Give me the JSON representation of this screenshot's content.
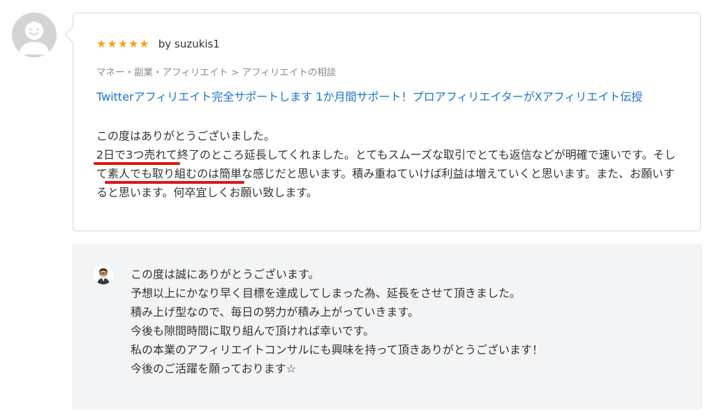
{
  "reviewer": {
    "avatar_icon": "default-user-avatar-icon"
  },
  "review": {
    "rating": 5,
    "star_color": "#f5a01a",
    "byline": "by suzukis1",
    "breadcrumb": "マネー・副業・アフィリエイト > アフィリエイトの相談",
    "service_title": "Twitterアフィリエイト完全サポートします 1か月間サポート！プロアフィリエイターがXアフィリエイト伝授",
    "link_color": "#1a73c9",
    "line1": "この度はありがとうございました。",
    "para2_hl1": "2日で3つ売れて",
    "para2_mid": "終了のところ延長してくれました。とてもスムーズな取引でとても返信などが明確で速いです。そして",
    "para2_hl2": "素人でも取り組むのは簡単",
    "para2_end": "な感じだと思います。積み重ねていけば利益は増えていくと思います。また、お願いすると思います。何卒宜しくお願い致します。",
    "underline_color": "#e01212"
  },
  "reply": {
    "avatar_icon": "seller-avatar-icon",
    "lines": [
      "この度は誠にありがとうございます。",
      "予想以上にかなり早く目標を達成してしまった為、延長をさせて頂きました。",
      "積み上げ型なので、毎日の努力が積み上がっていきます。",
      "今後も隙間時間に取り組んで頂ければ幸いです。",
      "私の本業のアフィリエイトコンサルにも興味を持って頂きありがとうございます！",
      "今後のご活躍を願っております☆"
    ]
  }
}
